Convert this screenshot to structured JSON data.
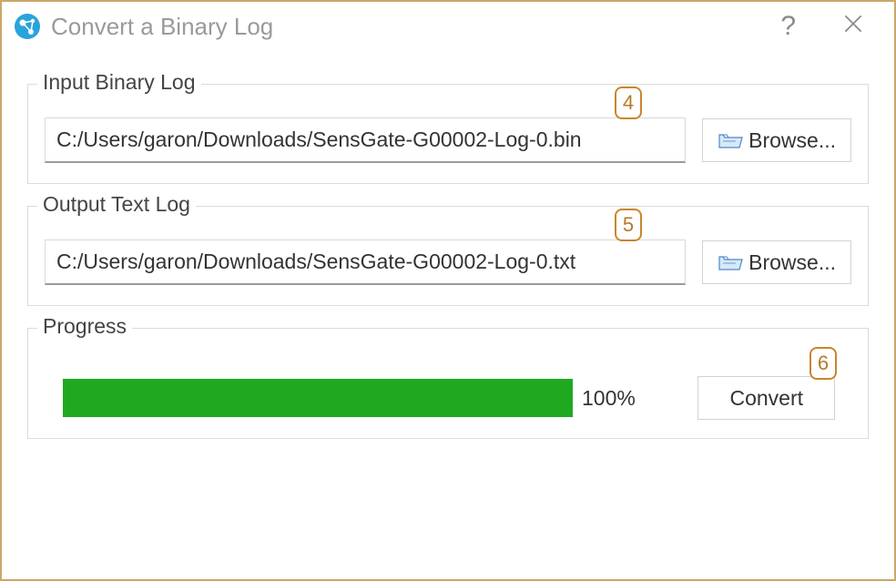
{
  "window": {
    "title": "Convert a Binary Log"
  },
  "inputSection": {
    "legend": "Input Binary Log",
    "path": "C:/Users/garon/Downloads/SensGate-G00002-Log-0.bin",
    "browse": "Browse...",
    "callout": "4"
  },
  "outputSection": {
    "legend": "Output Text Log",
    "path": "C:/Users/garon/Downloads/SensGate-G00002-Log-0.txt",
    "browse": "Browse...",
    "callout": "5"
  },
  "progressSection": {
    "legend": "Progress",
    "percent": "100%",
    "convert": "Convert",
    "callout": "6"
  }
}
